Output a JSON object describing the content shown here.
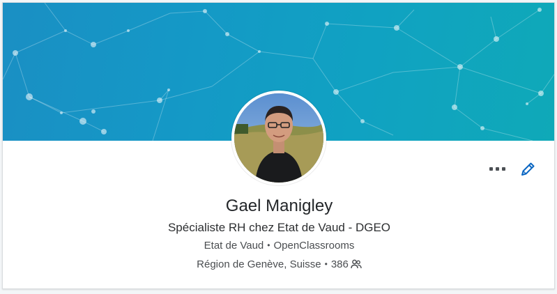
{
  "profile": {
    "name": "Gael Manigley",
    "headline": "Spécialiste RH chez Etat de Vaud - DGEO",
    "current_company": "Etat de Vaud",
    "education": "OpenClassrooms",
    "location": "Région de Genève, Suisse",
    "connections": "386",
    "separator": "•"
  },
  "icons": {
    "more": "more-horizontal-icon",
    "edit": "pencil-icon",
    "connections": "people-icon"
  },
  "colors": {
    "banner_start": "#1a8fc4",
    "banner_end": "#0fa9b8",
    "edit_icon": "#0a66c2",
    "text_primary": "#232629",
    "text_secondary": "#4a4d50"
  }
}
